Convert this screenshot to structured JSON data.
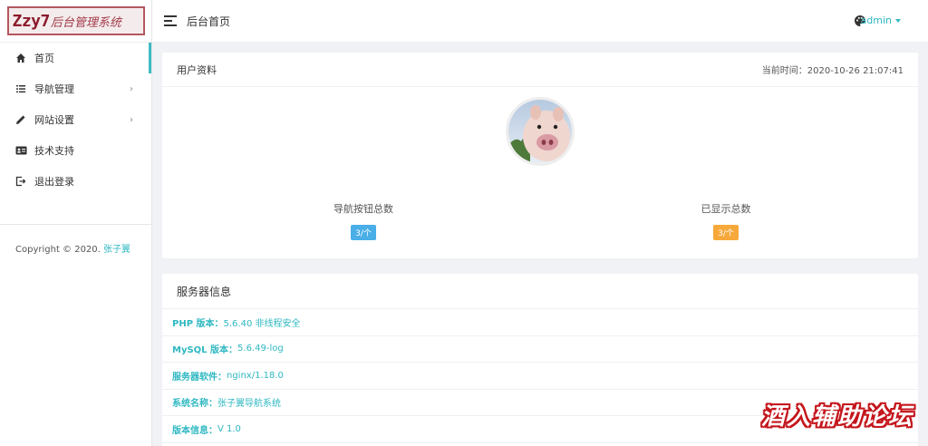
{
  "logo": {
    "text_latin": "Zzy7",
    "text_cn": "后台管理系统"
  },
  "sidebar": {
    "items": [
      {
        "label": "首页",
        "icon": "home-icon",
        "active": true,
        "has_children": false
      },
      {
        "label": "导航管理",
        "icon": "list-icon",
        "active": false,
        "has_children": true
      },
      {
        "label": "网站设置",
        "icon": "pencil-icon",
        "active": false,
        "has_children": true
      },
      {
        "label": "技术支持",
        "icon": "id-card-icon",
        "active": false,
        "has_children": false
      },
      {
        "label": "退出登录",
        "icon": "logout-icon",
        "active": false,
        "has_children": false
      }
    ],
    "copyright_prefix": "Copyright © 2020.",
    "copyright_author": "张子翼"
  },
  "header": {
    "title": "后台首页",
    "user": "admin"
  },
  "profile": {
    "title": "用户资料",
    "time_label": "当前时间：2020-10-26 21:07:41",
    "stats": [
      {
        "label": "导航按钮总数",
        "badge": "3/个",
        "color": "#4aaee7"
      },
      {
        "label": "已显示总数",
        "badge": "3/个",
        "color": "#f7a83b"
      }
    ]
  },
  "server": {
    "title": "服务器信息",
    "rows": [
      {
        "key": "PHP 版本：",
        "value": "5.6.40 非线程安全"
      },
      {
        "key": "MySQL 版本：",
        "value": "5.6.49-log"
      },
      {
        "key": "服务器软件：",
        "value": "nginx/1.18.0"
      },
      {
        "key": "系统名称：",
        "value": "张子翼导航系统"
      },
      {
        "key": "版本信息：",
        "value": "V 1.0"
      }
    ]
  },
  "watermark": "酒入辅助论坛",
  "colors": {
    "accent": "#2fb8c2",
    "badge_blue": "#4aaee7",
    "badge_orange": "#f7a83b"
  }
}
